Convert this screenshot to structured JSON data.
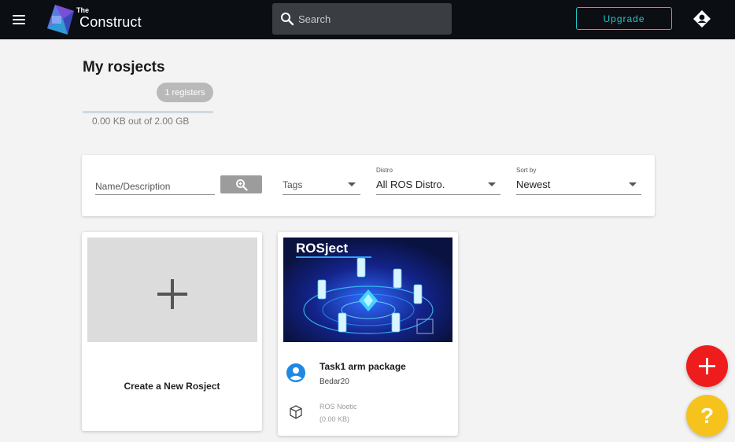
{
  "app": {
    "logo_small": "The",
    "logo_big": "Construct"
  },
  "topbar": {
    "search_placeholder": "Search",
    "upgrade_label": "Upgrade"
  },
  "page": {
    "title": "My rosjects",
    "registers_badge": "1 registers",
    "storage_used_fraction": 0.0,
    "storage_text": "0.00 KB out of 2.00 GB"
  },
  "filters": {
    "name_placeholder": "Name/Description",
    "tags_value": "Tags",
    "distro_label": "Distro",
    "distro_value": "All ROS Distro.",
    "sort_label": "Sort by",
    "sort_value": "Newest"
  },
  "create_card": {
    "label": "Create a New Rosject"
  },
  "rosjects": [
    {
      "thumbnail_title": "ROSject",
      "name": "Task1 arm package",
      "owner": "Bedar20",
      "distro": "ROS Noetic",
      "size": "(0.00 KB)"
    }
  ],
  "fab": {
    "help_label": "?"
  },
  "colors": {
    "topbar_bg": "#0b0f14",
    "accent_teal": "#1ec8c8",
    "fab_add": "#ee1c1c",
    "fab_help": "#f6c31c",
    "owner_icon": "#1e88e5"
  },
  "icons": {
    "menu": "hamburger-menu-icon",
    "search": "magnifier-icon",
    "avatar": "user-avatar-icon",
    "filter_search": "zoom-search-icon",
    "owner": "account-circle-icon",
    "distro": "package-cube-icon",
    "add": "plus-icon",
    "help": "question-mark-icon"
  }
}
